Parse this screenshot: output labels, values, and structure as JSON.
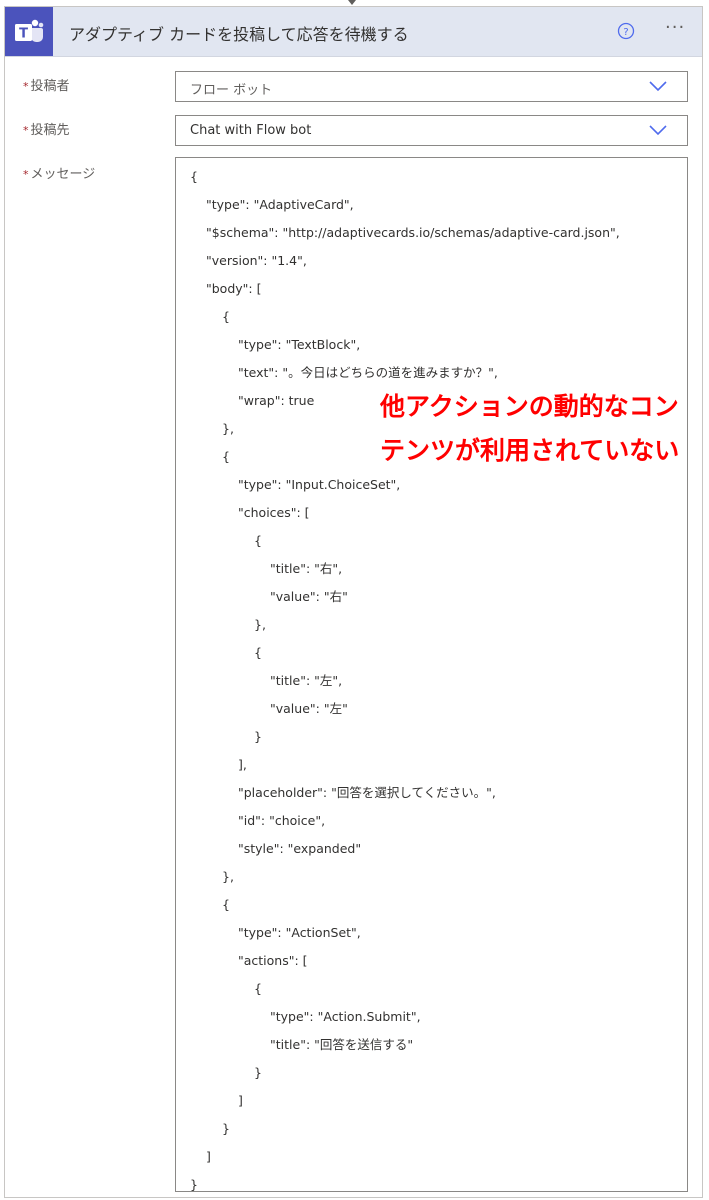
{
  "header": {
    "title": "アダプティブ カードを投稿して応答を待機する",
    "help_icon": "help-circle-icon",
    "more_icon": "ellipsis-icon",
    "more_glyph": "···",
    "app_icon": "teams-icon",
    "app_icon_color": "#4b53bc"
  },
  "fields": {
    "required_marker": "*",
    "poster": {
      "label": "投稿者",
      "value": "フロー ボット"
    },
    "post_in": {
      "label": "投稿先",
      "value": "Chat with Flow bot"
    },
    "message": {
      "label": "メッセージ",
      "lines": [
        "{",
        "\"type\": \"AdaptiveCard\",",
        "\"$schema\": \"http://adaptivecards.io/schemas/adaptive-card.json\",",
        "\"version\": \"1.4\",",
        "\"body\": [",
        "{",
        "\"type\": \"TextBlock\",",
        "\"text\": \"。今日はどちらの道を進みますか？\",",
        "\"wrap\": true",
        "},",
        "{",
        "\"type\": \"Input.ChoiceSet\",",
        "\"choices\": [",
        "{",
        "\"title\": \"右\",",
        "\"value\": \"右\"",
        "},",
        "{",
        "\"title\": \"左\",",
        "\"value\": \"左\"",
        "}",
        "],",
        "\"placeholder\": \"回答を選択してください。\",",
        "\"id\": \"choice\",",
        "\"style\": \"expanded\"",
        "},",
        "{",
        "\"type\": \"ActionSet\",",
        "\"actions\": [",
        "{",
        "\"type\": \"Action.Submit\",",
        "\"title\": \"回答を送信する\"",
        "}",
        "]",
        "}",
        "]",
        "}"
      ]
    }
  },
  "annotation": {
    "text": "他アクションの動的なコンテンツが利用されていない",
    "color": "#ff0000"
  }
}
